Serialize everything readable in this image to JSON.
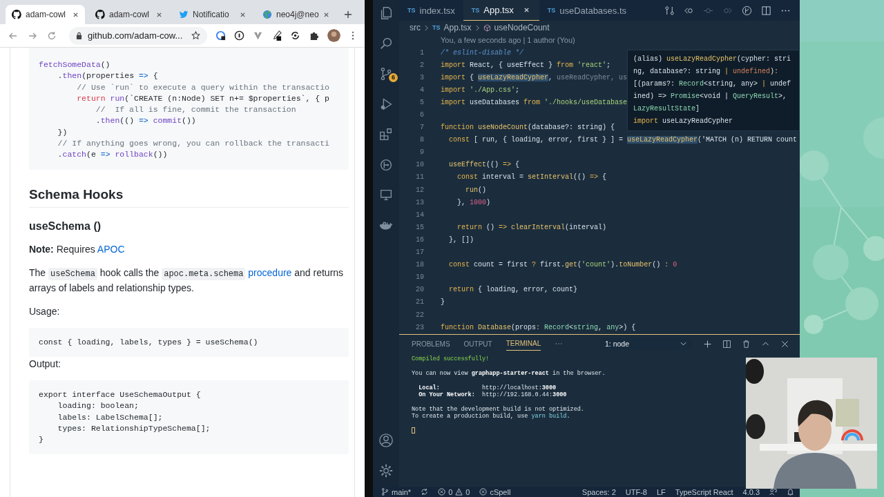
{
  "browser": {
    "tabs": [
      {
        "kind": "github",
        "label": "adam-cowl",
        "selected": true
      },
      {
        "kind": "github",
        "label": "adam-cowl",
        "selected": false
      },
      {
        "kind": "bird",
        "label": "Notificatio",
        "selected": false
      },
      {
        "kind": "globe",
        "label": "neo4j@neo",
        "selected": false
      }
    ],
    "url": "github.com/adam-cow..."
  },
  "page": {
    "code_top": [
      [
        {
          "kind": "f",
          "text": "fetchSomeData"
        },
        {
          "kind": "p",
          "text": "()"
        }
      ],
      [
        {
          "kind": "p",
          "text": "    ."
        },
        {
          "kind": "f",
          "text": "then"
        },
        {
          "kind": "p",
          "text": "(properties "
        },
        {
          "kind": "o",
          "text": "=>"
        },
        {
          "kind": "p",
          "text": " {"
        }
      ],
      [
        {
          "kind": "c",
          "text": "        // Use `run` to execute a query within the transactio"
        }
      ],
      [
        {
          "kind": "k",
          "text": "        return "
        },
        {
          "kind": "f",
          "text": "run"
        },
        {
          "kind": "p",
          "text": "(`CREATE (n:Node) SET n+= $properties`, { p"
        }
      ],
      [
        {
          "kind": "c",
          "text": "            //  If all is fine, commit the transaction"
        }
      ],
      [
        {
          "kind": "p",
          "text": "            ."
        },
        {
          "kind": "f",
          "text": "then"
        },
        {
          "kind": "p",
          "text": "(() "
        },
        {
          "kind": "o",
          "text": "=>"
        },
        {
          "kind": "f",
          "text": " commit"
        },
        {
          "kind": "p",
          "text": "())"
        }
      ],
      [
        {
          "kind": "p",
          "text": "    })"
        }
      ],
      [
        {
          "kind": "c",
          "text": "    // If anything goes wrong, you can rollback the transacti"
        }
      ],
      [
        {
          "kind": "p",
          "text": "    ."
        },
        {
          "kind": "f",
          "text": "catch"
        },
        {
          "kind": "p",
          "text": "(e "
        },
        {
          "kind": "o",
          "text": "=>"
        },
        {
          "kind": "f",
          "text": " rollback"
        },
        {
          "kind": "p",
          "text": "())"
        }
      ]
    ],
    "heading": "Schema Hooks",
    "subheading": "useSchema ()",
    "note": [
      {
        "kind": "bold",
        "text": "Note:"
      },
      {
        "kind": "text",
        "text": " Requires "
      },
      {
        "kind": "link",
        "text": "APOC"
      }
    ],
    "description": [
      {
        "kind": "text",
        "text": "The "
      },
      {
        "kind": "code",
        "text": "useSchema"
      },
      {
        "kind": "text",
        "text": " hook calls the "
      },
      {
        "kind": "code",
        "text": "apoc.meta.schema"
      },
      {
        "kind": "link",
        "text": " procedure"
      },
      {
        "kind": "text",
        "text": " and returns arrays of labels and relationship types."
      }
    ],
    "usage_label": "Usage:",
    "usage_code": [
      "const { loading, labels, types } = useSchema()"
    ],
    "output_label": "Output:",
    "output_code": [
      "export interface UseSchemaOutput {",
      "    loading: boolean;",
      "    labels: LabelSchema[];",
      "    types: RelationshipTypeSchema[];",
      "}"
    ]
  },
  "activity": {
    "scm_badge": "6"
  },
  "editor": {
    "tabs": [
      {
        "badge": "TS",
        "label": "index.tsx",
        "selected": false
      },
      {
        "badge": "TS",
        "label": "App.tsx",
        "selected": true
      },
      {
        "badge": "TS",
        "label": "useDatabases.ts",
        "selected": false
      }
    ],
    "breadcrumb": [
      {
        "kind": "folder",
        "label": "src"
      },
      {
        "kind": "file",
        "badge": "TS",
        "label": "App.tsx"
      },
      {
        "kind": "symbol",
        "label": "useNodeCount"
      }
    ],
    "codelens": "You, a few seconds ago | 1 author (You)",
    "lines": [
      {
        "num": "1",
        "tokens": [
          {
            "kind": "c",
            "text": "/* eslint-disable */"
          }
        ]
      },
      {
        "num": "2",
        "tokens": [
          {
            "kind": "k",
            "text": "import "
          },
          {
            "kind": "p",
            "text": "React, { useEffect } "
          },
          {
            "kind": "k",
            "text": "from "
          },
          {
            "kind": "s",
            "text": "'react'"
          },
          {
            "kind": "p",
            "text": ";"
          }
        ]
      },
      {
        "num": "3",
        "tokens": [
          {
            "kind": "k",
            "text": "import "
          },
          {
            "kind": "p",
            "text": "{ "
          },
          {
            "kind": "h",
            "text": "useLazyReadCypher"
          },
          {
            "kind": "p",
            "text": ", "
          },
          {
            "kind": "d",
            "text": "useReadCypher, us"
          }
        ]
      },
      {
        "num": "4",
        "tokens": [
          {
            "kind": "k",
            "text": "import "
          },
          {
            "kind": "s",
            "text": "'./App.css'"
          },
          {
            "kind": "p",
            "text": ";"
          }
        ]
      },
      {
        "num": "5",
        "tokens": [
          {
            "kind": "k",
            "text": "import "
          },
          {
            "kind": "p",
            "text": "useDatabases "
          },
          {
            "kind": "k",
            "text": "from "
          },
          {
            "kind": "s",
            "text": "'./hooks/useDatabase"
          }
        ]
      },
      {
        "num": "6"
      },
      {
        "num": "7",
        "tokens": [
          {
            "kind": "k",
            "text": "function "
          },
          {
            "kind": "f",
            "text": "useNodeCount"
          },
          {
            "kind": "p",
            "text": "(database?: string) {"
          }
        ]
      },
      {
        "num": "8",
        "tokens": [
          {
            "kind": "k",
            "text": "  const "
          },
          {
            "kind": "p",
            "text": "[ run, { loading, error, first } ] = "
          },
          {
            "kind": "h",
            "text": "useLazyReadCypher"
          },
          {
            "kind": "p",
            "text": "('MATCH (n) RETURN count"
          }
        ]
      },
      {
        "num": "9"
      },
      {
        "num": "10",
        "tokens": [
          {
            "kind": "f",
            "text": "  useEffect"
          },
          {
            "kind": "p",
            "text": "(() "
          },
          {
            "kind": "k",
            "text": "=>"
          },
          {
            "kind": "p",
            "text": " {"
          }
        ]
      },
      {
        "num": "11",
        "tokens": [
          {
            "kind": "k",
            "text": "    const "
          },
          {
            "kind": "p",
            "text": "interval = "
          },
          {
            "kind": "f",
            "text": "setInterval"
          },
          {
            "kind": "p",
            "text": "(() "
          },
          {
            "kind": "k",
            "text": "=>"
          },
          {
            "kind": "p",
            "text": " {"
          }
        ]
      },
      {
        "num": "12",
        "tokens": [
          {
            "kind": "f",
            "text": "      run"
          },
          {
            "kind": "p",
            "text": "()"
          }
        ]
      },
      {
        "num": "13",
        "tokens": [
          {
            "kind": "p",
            "text": "    }, "
          },
          {
            "kind": "n",
            "text": "1000"
          },
          {
            "kind": "p",
            "text": ")"
          }
        ]
      },
      {
        "num": "14"
      },
      {
        "num": "15",
        "tokens": [
          {
            "kind": "k",
            "text": "    return "
          },
          {
            "kind": "p",
            "text": "() "
          },
          {
            "kind": "k",
            "text": "=>"
          },
          {
            "kind": "f",
            "text": " clearInterval"
          },
          {
            "kind": "p",
            "text": "(interval)"
          }
        ]
      },
      {
        "num": "16",
        "tokens": [
          {
            "kind": "p",
            "text": "  }, [])"
          }
        ]
      },
      {
        "num": "17"
      },
      {
        "num": "18",
        "tokens": [
          {
            "kind": "k",
            "text": "  const "
          },
          {
            "kind": "p",
            "text": "count = first "
          },
          {
            "kind": "k",
            "text": "?"
          },
          {
            "kind": "p",
            "text": " first."
          },
          {
            "kind": "f",
            "text": "get"
          },
          {
            "kind": "p",
            "text": "("
          },
          {
            "kind": "s",
            "text": "'count'"
          },
          {
            "kind": "p",
            "text": ")."
          },
          {
            "kind": "f",
            "text": "toNumber"
          },
          {
            "kind": "p",
            "text": "() "
          },
          {
            "kind": "k",
            "text": ":"
          },
          {
            "kind": "n",
            "text": " 0"
          }
        ]
      },
      {
        "num": "19"
      },
      {
        "num": "20",
        "tokens": [
          {
            "kind": "k",
            "text": "  return "
          },
          {
            "kind": "p",
            "text": "{ loading, error, count}"
          }
        ]
      },
      {
        "num": "21",
        "tokens": [
          {
            "kind": "p",
            "text": "}"
          }
        ]
      },
      {
        "num": "22"
      },
      {
        "num": "23",
        "tokens": [
          {
            "kind": "k",
            "text": "function "
          },
          {
            "kind": "f",
            "text": "Database"
          },
          {
            "kind": "p",
            "text": "(props"
          },
          {
            "kind": "k",
            "text": ": "
          },
          {
            "kind": "t",
            "text": "Record"
          },
          {
            "kind": "p",
            "text": "<"
          },
          {
            "kind": "t",
            "text": "string"
          },
          {
            "kind": "p",
            "text": ", "
          },
          {
            "kind": "t",
            "text": "any"
          },
          {
            "kind": "p",
            "text": ">) {"
          }
        ]
      }
    ],
    "hover": [
      [
        {
          "kind": "p",
          "text": "(alias) "
        },
        {
          "kind": "f",
          "text": "useLazyReadCypher"
        },
        {
          "kind": "p",
          "text": "(cypher: stri"
        }
      ],
      [
        {
          "kind": "p",
          "text": "ng, database?: string "
        },
        {
          "kind": "k",
          "text": "| "
        },
        {
          "kind": "o",
          "text": "undefined"
        },
        {
          "kind": "p",
          "text": ")"
        },
        {
          "kind": "k",
          "text": ":"
        }
      ],
      [
        {
          "kind": "p",
          "text": "[(params?: "
        },
        {
          "kind": "t",
          "text": "Record"
        },
        {
          "kind": "p",
          "text": "<string, any> "
        },
        {
          "kind": "k",
          "text": "| "
        },
        {
          "kind": "p",
          "text": "undef"
        }
      ],
      [
        {
          "kind": "p",
          "text": "ined) => "
        },
        {
          "kind": "t",
          "text": "Promise"
        },
        {
          "kind": "p",
          "text": "<void | "
        },
        {
          "kind": "t",
          "text": "QueryResult"
        },
        {
          "kind": "p",
          "text": ">,"
        }
      ],
      [
        {
          "kind": "t",
          "text": "LazyResultState"
        },
        {
          "kind": "p",
          "text": "]"
        }
      ],
      [
        {
          "kind": "k",
          "text": "import "
        },
        {
          "kind": "p",
          "text": "useLazyReadCypher"
        }
      ]
    ]
  },
  "panel": {
    "tabs": [
      {
        "label": "PROBLEMS",
        "selected": false
      },
      {
        "label": "OUTPUT",
        "selected": false
      },
      {
        "label": "TERMINAL",
        "selected": true
      }
    ],
    "terminal_select": "1: node",
    "lines": [
      {
        "kind": "text",
        "tokens": [
          {
            "kind": "g",
            "text": "Compiled successfully!"
          }
        ]
      },
      {
        "kind": "blank"
      },
      {
        "kind": "text",
        "tokens": [
          {
            "kind": "p",
            "text": "You can now view "
          },
          {
            "kind": "b",
            "text": "graphapp-starter-react"
          },
          {
            "kind": "p",
            "text": " in the browser."
          }
        ]
      },
      {
        "kind": "blank"
      },
      {
        "kind": "text",
        "tokens": [
          {
            "kind": "b",
            "text": "  Local:"
          },
          {
            "kind": "p",
            "text": "            http://localhost:"
          },
          {
            "kind": "b",
            "text": "3000"
          }
        ]
      },
      {
        "kind": "text",
        "tokens": [
          {
            "kind": "b",
            "text": "  On Your Network:"
          },
          {
            "kind": "p",
            "text": "  http://192.168.0.44:"
          },
          {
            "kind": "b",
            "text": "3000"
          }
        ]
      },
      {
        "kind": "blank"
      },
      {
        "kind": "text",
        "tokens": [
          {
            "kind": "p",
            "text": "Note that the development build is not optimized."
          }
        ]
      },
      {
        "kind": "text",
        "tokens": [
          {
            "kind": "p",
            "text": "To create a production build, use "
          },
          {
            "kind": "y",
            "text": "yarn build"
          },
          {
            "kind": "p",
            "text": "."
          }
        ]
      }
    ]
  },
  "status_bar": {
    "branch": "main*",
    "errors": "0",
    "warnings": "0",
    "spell": "cSpell",
    "items": [
      "Spaces: 2",
      "UTF-8",
      "LF",
      "TypeScript React",
      "4.0.3"
    ]
  }
}
